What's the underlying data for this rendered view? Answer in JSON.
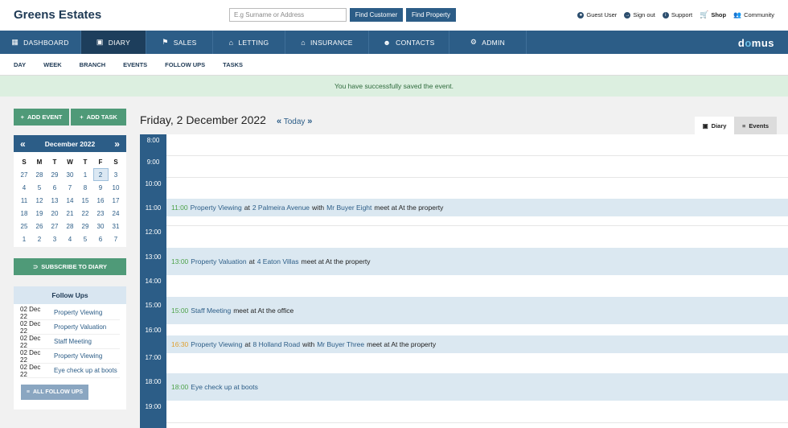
{
  "brand": "Greens Estates",
  "search": {
    "placeholder": "E.g Surname or Address",
    "find_customer": "Find Customer",
    "find_property": "Find Property"
  },
  "toplinks": {
    "guest_user": "Guest User",
    "sign_out": "Sign out",
    "support": "Support",
    "shop": "Shop",
    "community": "Community"
  },
  "mainnav": [
    "DASHBOARD",
    "DIARY",
    "SALES",
    "LETTING",
    "INSURANCE",
    "CONTACTS",
    "ADMIN"
  ],
  "logo": {
    "pre": "d",
    "o": "o",
    "post": "mus"
  },
  "subnav": [
    "DAY",
    "WEEK",
    "BRANCH",
    "EVENTS",
    "FOLLOW UPS",
    "TASKS"
  ],
  "alert": "You have successfully saved the event.",
  "sidebar": {
    "add_event": "ADD EVENT",
    "add_task": "ADD TASK",
    "subscribe": "SUBSCRIBE TO DIARY"
  },
  "calendar": {
    "month": "December 2022",
    "days": [
      "S",
      "M",
      "T",
      "W",
      "T",
      "F",
      "S"
    ],
    "weeks": [
      [
        "27",
        "28",
        "29",
        "30",
        "1",
        "2",
        "3"
      ],
      [
        "4",
        "5",
        "6",
        "7",
        "8",
        "9",
        "10"
      ],
      [
        "11",
        "12",
        "13",
        "14",
        "15",
        "16",
        "17"
      ],
      [
        "18",
        "19",
        "20",
        "21",
        "22",
        "23",
        "24"
      ],
      [
        "25",
        "26",
        "27",
        "28",
        "29",
        "30",
        "31"
      ],
      [
        "1",
        "2",
        "3",
        "4",
        "5",
        "6",
        "7"
      ]
    ],
    "selected": "2"
  },
  "followups": {
    "title": "Follow Ups",
    "items": [
      {
        "date": "02 Dec 22",
        "title": "Property Viewing"
      },
      {
        "date": "02 Dec 22",
        "title": "Property Valuation"
      },
      {
        "date": "02 Dec 22",
        "title": "Staff Meeting"
      },
      {
        "date": "02 Dec 22",
        "title": "Property Viewing"
      },
      {
        "date": "02 Dec 22",
        "title": "Eye check up at boots"
      }
    ],
    "all_button": "ALL FOLLOW UPS"
  },
  "diary": {
    "title": "Friday, 2 December 2022",
    "today": "Today",
    "tab_diary": "Diary",
    "tab_events": "Events",
    "times": [
      "8:00",
      "9:00",
      "10:00",
      "11:00",
      "12:00",
      "13:00",
      "14:00",
      "15:00",
      "16:00",
      "17:00",
      "18:00",
      "19:00"
    ],
    "events": {
      "e1": {
        "time": "11:00",
        "title": "Property Viewing",
        "at": "at",
        "place": "2 Palmeira Avenue",
        "with": "with",
        "who": "Mr Buyer Eight",
        "rest": "meet at At the property"
      },
      "e2": {
        "time": "13:00",
        "title": "Property Valuation",
        "at": "at",
        "place": "4 Eaton Villas",
        "rest": "meet at At the property"
      },
      "e3": {
        "time": "15:00",
        "title": "Staff Meeting",
        "rest": "meet at At the office"
      },
      "e4": {
        "time": "16:30",
        "title": "Property Viewing",
        "at": "at",
        "place": "8 Holland Road",
        "with": "with",
        "who": "Mr Buyer Three",
        "rest": "meet at At the property"
      },
      "e5": {
        "time": "18:00",
        "title": "Eye check up at boots"
      }
    }
  }
}
